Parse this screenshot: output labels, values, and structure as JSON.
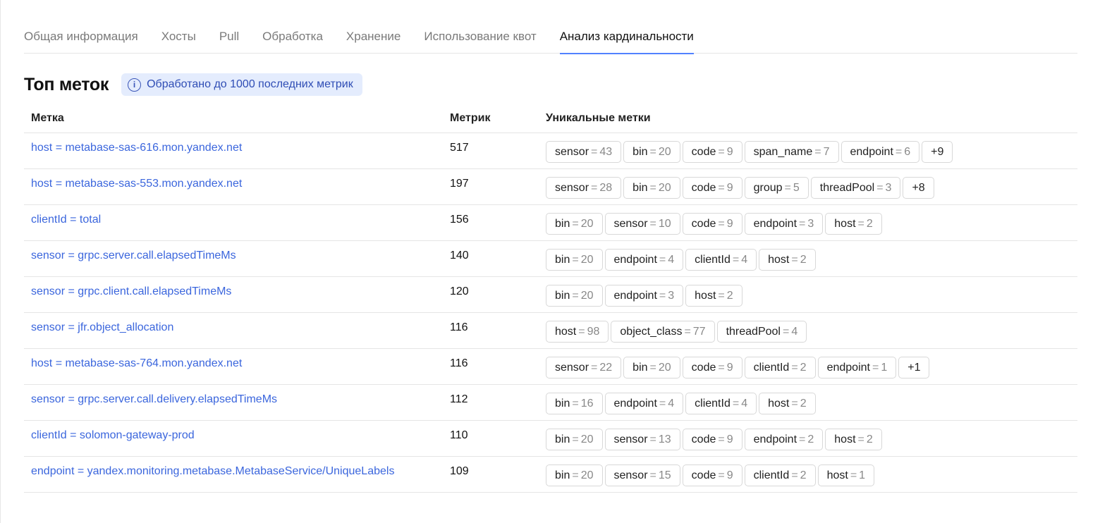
{
  "tabs": [
    {
      "label": "Общая информация",
      "active": false
    },
    {
      "label": "Хосты",
      "active": false
    },
    {
      "label": "Pull",
      "active": false
    },
    {
      "label": "Обработка",
      "active": false
    },
    {
      "label": "Хранение",
      "active": false
    },
    {
      "label": "Использование квот",
      "active": false
    },
    {
      "label": "Анализ кардинальности",
      "active": true
    }
  ],
  "header": {
    "title": "Топ меток",
    "info_text": "Обработано до 1000 последних метрик",
    "info_icon": "info-icon"
  },
  "table": {
    "columns": [
      "Метка",
      "Метрик",
      "Уникальные метки"
    ],
    "rows": [
      {
        "label": "host = metabase-sas-616.mon.yandex.net",
        "count": "517",
        "chips": [
          {
            "k": "sensor",
            "v": "43"
          },
          {
            "k": "bin",
            "v": "20"
          },
          {
            "k": "code",
            "v": "9"
          },
          {
            "k": "span_name",
            "v": "7"
          },
          {
            "k": "endpoint",
            "v": "6"
          }
        ],
        "more": "+9"
      },
      {
        "label": "host = metabase-sas-553.mon.yandex.net",
        "count": "197",
        "chips": [
          {
            "k": "sensor",
            "v": "28"
          },
          {
            "k": "bin",
            "v": "20"
          },
          {
            "k": "code",
            "v": "9"
          },
          {
            "k": "group",
            "v": "5"
          },
          {
            "k": "threadPool",
            "v": "3"
          }
        ],
        "more": "+8"
      },
      {
        "label": "clientId = total",
        "count": "156",
        "chips": [
          {
            "k": "bin",
            "v": "20"
          },
          {
            "k": "sensor",
            "v": "10"
          },
          {
            "k": "code",
            "v": "9"
          },
          {
            "k": "endpoint",
            "v": "3"
          },
          {
            "k": "host",
            "v": "2"
          }
        ],
        "more": ""
      },
      {
        "label": "sensor = grpc.server.call.elapsedTimeMs",
        "count": "140",
        "chips": [
          {
            "k": "bin",
            "v": "20"
          },
          {
            "k": "endpoint",
            "v": "4"
          },
          {
            "k": "clientId",
            "v": "4"
          },
          {
            "k": "host",
            "v": "2"
          }
        ],
        "more": ""
      },
      {
        "label": "sensor = grpc.client.call.elapsedTimeMs",
        "count": "120",
        "chips": [
          {
            "k": "bin",
            "v": "20"
          },
          {
            "k": "endpoint",
            "v": "3"
          },
          {
            "k": "host",
            "v": "2"
          }
        ],
        "more": ""
      },
      {
        "label": "sensor = jfr.object_allocation",
        "count": "116",
        "chips": [
          {
            "k": "host",
            "v": "98"
          },
          {
            "k": "object_class",
            "v": "77"
          },
          {
            "k": "threadPool",
            "v": "4"
          }
        ],
        "more": ""
      },
      {
        "label": "host = metabase-sas-764.mon.yandex.net",
        "count": "116",
        "chips": [
          {
            "k": "sensor",
            "v": "22"
          },
          {
            "k": "bin",
            "v": "20"
          },
          {
            "k": "code",
            "v": "9"
          },
          {
            "k": "clientId",
            "v": "2"
          },
          {
            "k": "endpoint",
            "v": "1"
          }
        ],
        "more": "+1"
      },
      {
        "label": "sensor = grpc.server.call.delivery.elapsedTimeMs",
        "count": "112",
        "chips": [
          {
            "k": "bin",
            "v": "16"
          },
          {
            "k": "endpoint",
            "v": "4"
          },
          {
            "k": "clientId",
            "v": "4"
          },
          {
            "k": "host",
            "v": "2"
          }
        ],
        "more": ""
      },
      {
        "label": "clientId = solomon-gateway-prod",
        "count": "110",
        "chips": [
          {
            "k": "bin",
            "v": "20"
          },
          {
            "k": "sensor",
            "v": "13"
          },
          {
            "k": "code",
            "v": "9"
          },
          {
            "k": "endpoint",
            "v": "2"
          },
          {
            "k": "host",
            "v": "2"
          }
        ],
        "more": ""
      },
      {
        "label": "endpoint = yandex.monitoring.metabase.MetabaseService/UniqueLabels",
        "count": "109",
        "chips": [
          {
            "k": "bin",
            "v": "20"
          },
          {
            "k": "sensor",
            "v": "15"
          },
          {
            "k": "code",
            "v": "9"
          },
          {
            "k": "clientId",
            "v": "2"
          },
          {
            "k": "host",
            "v": "1"
          }
        ],
        "more": ""
      }
    ]
  },
  "colors": {
    "accent": "#5282ff",
    "link": "#3b66dd",
    "info_bg": "#e4ecfd"
  }
}
